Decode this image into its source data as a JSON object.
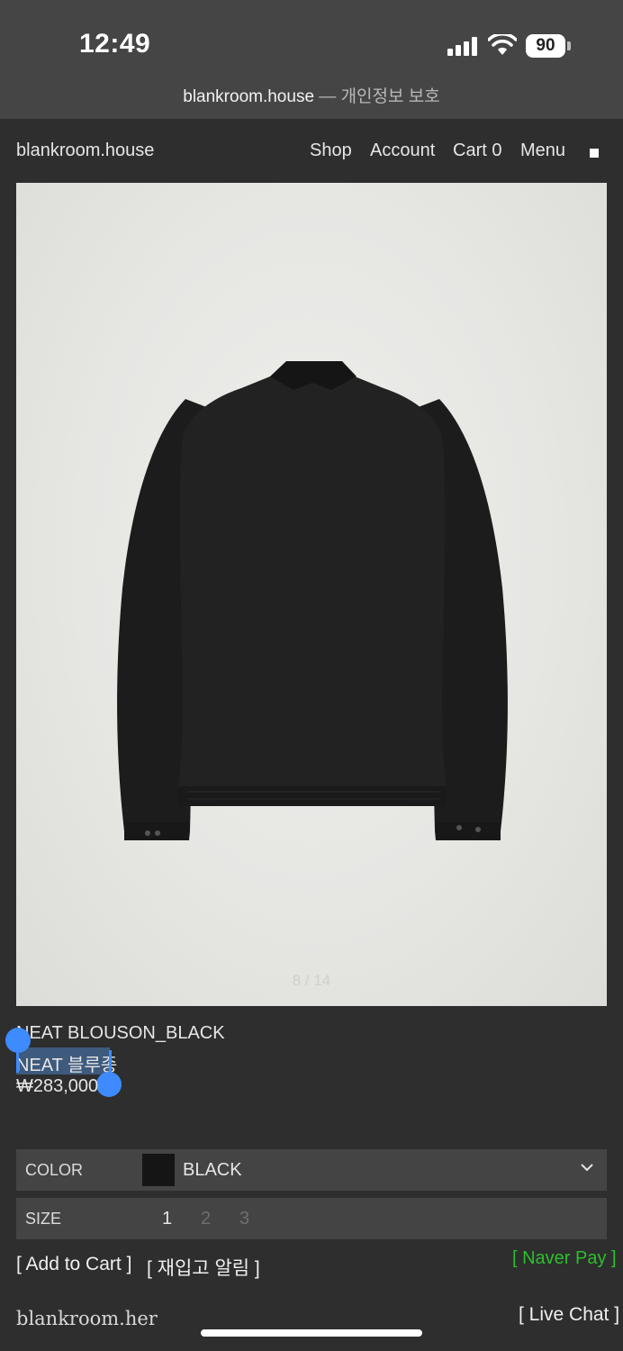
{
  "status_bar": {
    "time": "12:49",
    "battery": "90"
  },
  "browser": {
    "domain": "blankroom.house",
    "separator": " — ",
    "privacy_label": "개인정보 보호"
  },
  "header": {
    "logo": "blankroom.house",
    "nav": {
      "shop": "Shop",
      "account": "Account",
      "cart": "Cart 0",
      "menu": "Menu"
    }
  },
  "gallery": {
    "counter": "8 / 14",
    "image_alt": "black-blouson-back-view"
  },
  "product": {
    "name": "NEAT BLOUSON_BLACK",
    "name_ko": "NEAT 블루종",
    "price": "₩283,000",
    "selection": {
      "selected_text": "NEAT 블루종"
    }
  },
  "options": {
    "color": {
      "label": "COLOR",
      "value": "BLACK",
      "swatch_color": "#151515"
    },
    "size": {
      "label": "SIZE",
      "values": [
        "1",
        "2",
        "3"
      ],
      "selected": "1"
    }
  },
  "actions": {
    "add_to_cart": "[ Add to Cart ]",
    "restock_alert": "[ 재입고 알림 ]",
    "naver_pay": "[ Naver Pay ]",
    "live_chat": "[ Live Chat ]"
  },
  "footer": {
    "brand": "blankroom.her"
  },
  "colors": {
    "background": "#2e2e2e",
    "naver_green": "#2bc02b",
    "selection_blue": "#3e8bff"
  }
}
